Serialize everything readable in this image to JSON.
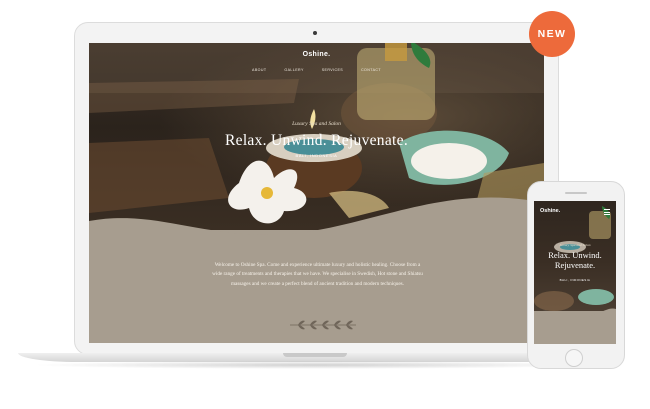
{
  "badge": {
    "label": "NEW"
  },
  "site": {
    "brand": "Oshine.",
    "nav": [
      "ABOUT",
      "GALLERY",
      "SERVICES",
      "CONTACT"
    ],
    "tagline": "Luxury Spa and Salon",
    "headline": "Relax. Unwind. Rejuvenate.",
    "location": "BALI, INDONESIA",
    "welcome": "Welcome to Oshine Spa. Come and experience ultimate luxury and holistic healing. Choose from a wide range of treatments and therapies that we have. We specialise in Swedish, Hot stone and Shiatsu massages and we create a perfect blend of ancient tradition and modern techniques."
  },
  "mobile": {
    "brand": "Oshine.",
    "tagline": "Luxury Spa and Salon",
    "headline": "Relax. Unwind. Rejuvenate.",
    "location": "BALI, INDONESIA",
    "menu_icon": "hamburger-menu-icon"
  },
  "colors": {
    "badge": "#ed6a3b",
    "section_bg": "#a79d8f",
    "hero_dark": "#2f261f"
  }
}
